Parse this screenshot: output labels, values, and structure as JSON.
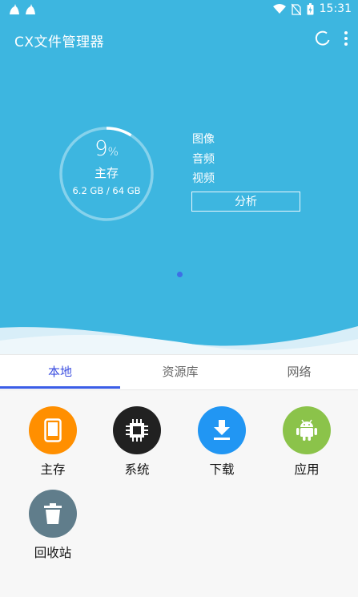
{
  "status_bar": {
    "time": "15:31"
  },
  "app_bar": {
    "title": "CX文件管理器"
  },
  "storage": {
    "percent_value": "9",
    "percent_sign": "%",
    "used_fraction": 0.09,
    "label": "主存",
    "size_text": "6.2 GB / 64 GB"
  },
  "legend": {
    "items": [
      "图像",
      "音频",
      "视频"
    ]
  },
  "analyze_label": "分析",
  "tabs": [
    {
      "label": "本地",
      "active": true
    },
    {
      "label": "资源库",
      "active": false
    },
    {
      "label": "网络",
      "active": false
    }
  ],
  "shortcuts": [
    {
      "label": "主存",
      "color": "#ff8f00",
      "icon": "tablet-icon"
    },
    {
      "label": "系统",
      "color": "#212121",
      "icon": "chip-icon"
    },
    {
      "label": "下载",
      "color": "#2196f3",
      "icon": "download-icon"
    },
    {
      "label": "应用",
      "color": "#8bc34a",
      "icon": "android-icon"
    },
    {
      "label": "回收站",
      "color": "#607d8b",
      "icon": "trash-icon"
    }
  ],
  "colors": {
    "hero_bg": "#3db6e0",
    "tab_active": "#3b4ee0"
  }
}
